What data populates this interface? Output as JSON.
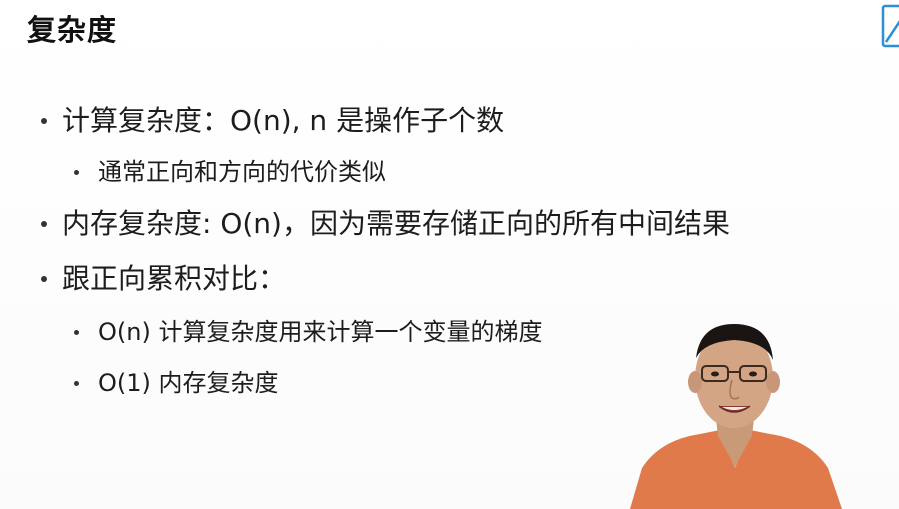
{
  "slide": {
    "title": "复杂度",
    "bullets": [
      {
        "level": 1,
        "text": "计算复杂度：O(n), n 是操作子个数"
      },
      {
        "level": 2,
        "text": "通常正向和方向的代价类似"
      },
      {
        "level": 1,
        "text": "内存复杂度: O(n)，因为需要存储正向的所有中间结果"
      },
      {
        "level": 1,
        "text": "跟正向累积对比："
      },
      {
        "level": 2,
        "text": "O(n) 计算复杂度用来计算一个变量的梯度"
      },
      {
        "level": 2,
        "text": "O(1) 内存复杂度"
      }
    ]
  },
  "icons": {
    "corner": "slide-corner-icon"
  },
  "colors": {
    "background": "#ffffff",
    "text": "#1d1d1d",
    "shirt": "#e07a4a",
    "accent": "#2b8fd6"
  }
}
